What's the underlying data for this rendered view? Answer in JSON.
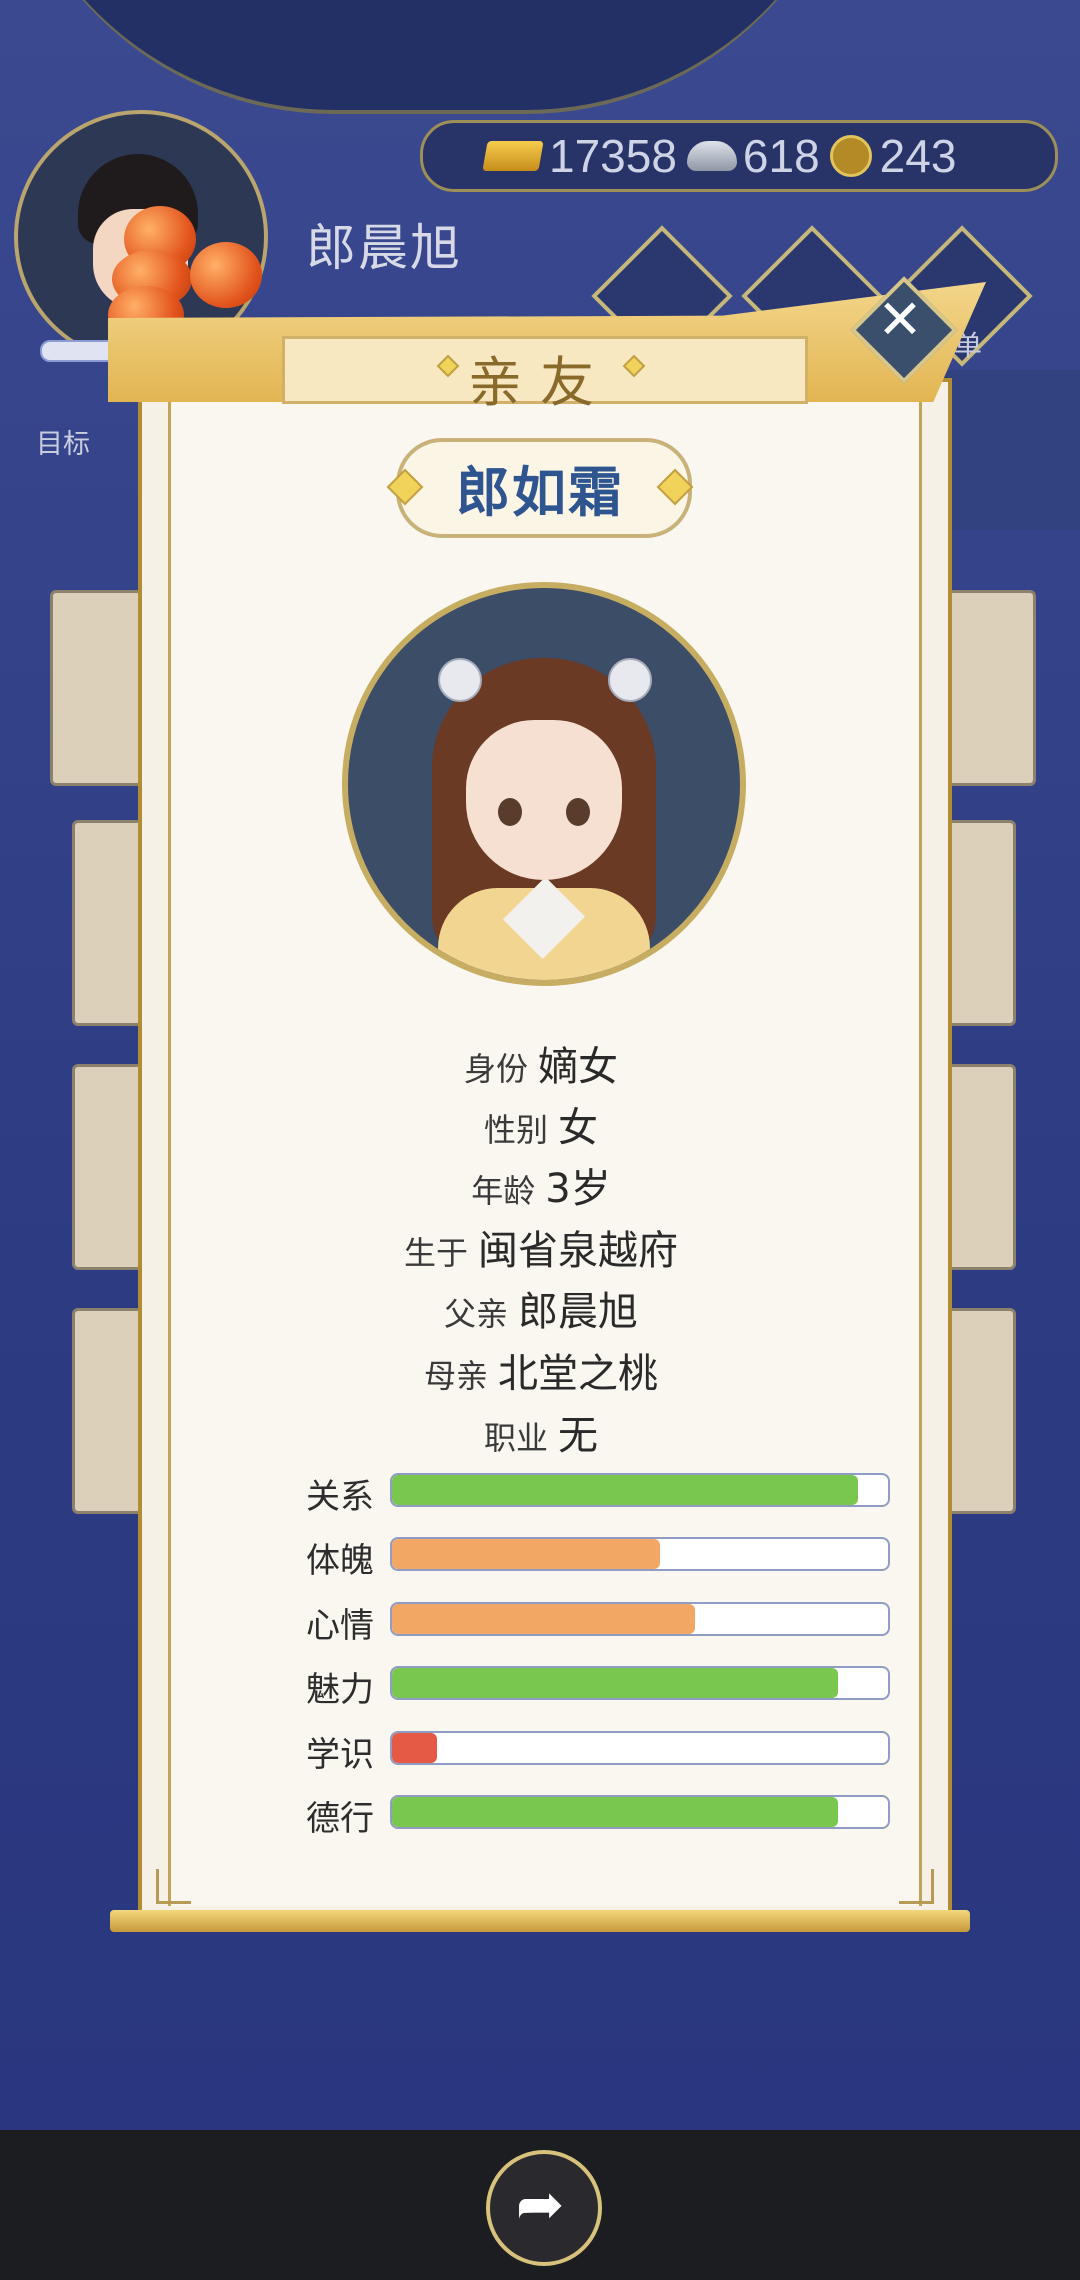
{
  "header": {
    "player_name": "郎晨旭",
    "goal_label": "目标",
    "menu_suffix": "单",
    "currency": {
      "gold": "17358",
      "silver": "618",
      "coin": "243"
    }
  },
  "modal": {
    "title": "亲友",
    "close_glyph": "✕",
    "name": "郎如霜",
    "info": [
      {
        "key": "身份",
        "value": "嫡女"
      },
      {
        "key": "性别",
        "value": "女"
      },
      {
        "key": "年龄",
        "value": "3岁"
      },
      {
        "key": "生于",
        "value": "闽省泉越府"
      },
      {
        "key": "父亲",
        "value": "郎晨旭"
      },
      {
        "key": "母亲",
        "value": "北堂之桃"
      },
      {
        "key": "职业",
        "value": "无"
      }
    ],
    "stats": [
      {
        "label": "关系",
        "level": 0.94,
        "color": "#7ac74f"
      },
      {
        "label": "体魄",
        "level": 0.54,
        "color": "#f2a764"
      },
      {
        "label": "心情",
        "level": 0.61,
        "color": "#f2a764"
      },
      {
        "label": "魅力",
        "level": 0.9,
        "color": "#7ac74f"
      },
      {
        "label": "学识",
        "level": 0.09,
        "color": "#e45a44"
      },
      {
        "label": "德行",
        "level": 0.9,
        "color": "#7ac74f"
      }
    ]
  },
  "footer": {
    "share_icon": "share-icon",
    "share_glyph": "➦"
  }
}
